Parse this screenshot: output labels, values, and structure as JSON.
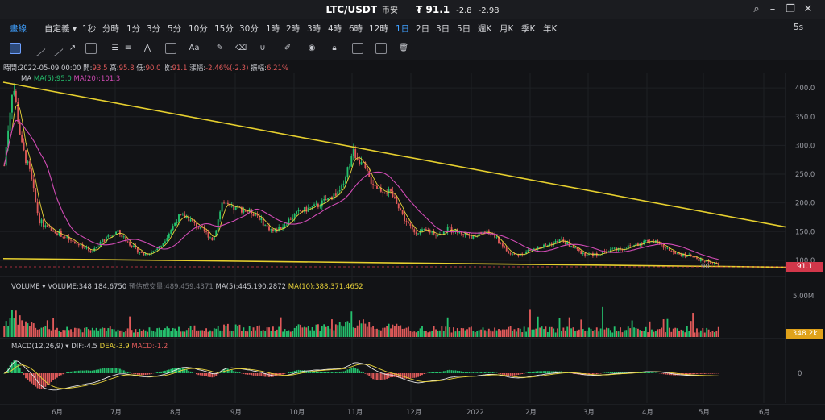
{
  "window": {
    "title": "LTC/USDT",
    "exchange": "币安",
    "price": "₮ 91.1",
    "change": "-2.8",
    "change_pct": "-2.98"
  },
  "timeframes": [
    {
      "label": "畫線",
      "active": true
    },
    {
      "label": "自定義 ▾"
    },
    {
      "label": "1秒"
    },
    {
      "label": "分時"
    },
    {
      "label": "1分"
    },
    {
      "label": "3分"
    },
    {
      "label": "5分"
    },
    {
      "label": "10分"
    },
    {
      "label": "15分"
    },
    {
      "label": "30分"
    },
    {
      "label": "1時"
    },
    {
      "label": "2時"
    },
    {
      "label": "3時"
    },
    {
      "label": "4時"
    },
    {
      "label": "6時"
    },
    {
      "label": "12時"
    },
    {
      "label": "1日",
      "active": true
    },
    {
      "label": "2日"
    },
    {
      "label": "3日"
    },
    {
      "label": "5日"
    },
    {
      "label": "週K"
    },
    {
      "label": "月K"
    },
    {
      "label": "季K"
    },
    {
      "label": "年K"
    }
  ],
  "interval_right": "5s",
  "toolbar_icons": [
    "crosshair-icon",
    "line-icon",
    "ray-icon",
    "arrow-icon",
    "rectangle-icon",
    "parallel-icon",
    "fib-icon",
    "pattern-icon",
    "measure-icon",
    "text-icon",
    "brush-icon",
    "eraser-icon",
    "lock-icon",
    "copy-icon",
    "hide-icon",
    "delete-icon"
  ],
  "info_line": {
    "time": "時間:2022-05-09 00:00",
    "open_label": "開:",
    "open": "93.5",
    "high_label": "高:",
    "high": "95.8",
    "low_label": "低:",
    "low": "90.0",
    "close_label": "收:",
    "close": "91.1",
    "change_label": "漲幅:",
    "change": "-2.46%(-2.3)",
    "amp_label": "振幅:",
    "amp": "6.21%"
  },
  "ma_legend": {
    "name": "MA",
    "ma5": "MA(5):95.0",
    "ma20": "MA(20):101.3"
  },
  "volume_legend": {
    "name": "VOLUME",
    "value": "VOLUME:348,184.6750",
    "est": "預估成交量:489,459.4371",
    "ma5": "MA(5):445,190.2872",
    "ma10": "MA(10):388,371.4652"
  },
  "macd_legend": {
    "name": "MACD(12,26,9)",
    "dif": "DIF:-4.5",
    "dea": "DEA:-3.9",
    "macd": "MACD:-1.2"
  },
  "price_tag": "91.1",
  "volume_tag": "348.2k",
  "low_marker": "90",
  "colors": {
    "up": "#25c26e",
    "down": "#e05a5a",
    "ma5": "#e8d23a",
    "ma20": "#d14bb5",
    "trendline": "#e6cf2e",
    "background": "#121316"
  },
  "chart_data": {
    "type": "candlestick",
    "price_axis": {
      "ticks": [
        400,
        350,
        300,
        250,
        200,
        150,
        100
      ],
      "tick_labels": [
        "400.0",
        "350.0",
        "300.0",
        "250.0",
        "200.0",
        "150.0",
        "100.0"
      ]
    },
    "volume_axis": {
      "ticks": [
        "5.00M"
      ]
    },
    "macd_axis": {
      "ticks": [
        "0"
      ]
    },
    "x_labels": [
      "6月",
      "7月",
      "8月",
      "9月",
      "10月",
      "11月",
      "12月",
      "2022",
      "2月",
      "3月",
      "4月",
      "5月",
      "6月"
    ],
    "close_series": {
      "note": "",
      "values": [
        265,
        410,
        300,
        250,
        170,
        155,
        150,
        140,
        130,
        125,
        115,
        130,
        140,
        150,
        135,
        120,
        110,
        115,
        125,
        150,
        175,
        175,
        160,
        150,
        135,
        200,
        190,
        190,
        185,
        180,
        160,
        150,
        160,
        175,
        185,
        190,
        195,
        205,
        215,
        230,
        290,
        270,
        240,
        225,
        220,
        205,
        170,
        150,
        150,
        150,
        145,
        155,
        150,
        145,
        140,
        150,
        145,
        130,
        110,
        110,
        115,
        120,
        125,
        130,
        135,
        125,
        115,
        110,
        110,
        115,
        120,
        120,
        125,
        130,
        135,
        130,
        120,
        115,
        110,
        105,
        100,
        97,
        91
      ]
    },
    "trendlines": [
      {
        "from": {
          "date": "2021-05-10",
          "price": 410
        },
        "to": {
          "date": "2022-06-20",
          "price": 158
        }
      },
      {
        "from": {
          "date": "2021-05-10",
          "price": 103
        },
        "to": {
          "date": "2022-06-20",
          "price": 88
        }
      }
    ]
  }
}
